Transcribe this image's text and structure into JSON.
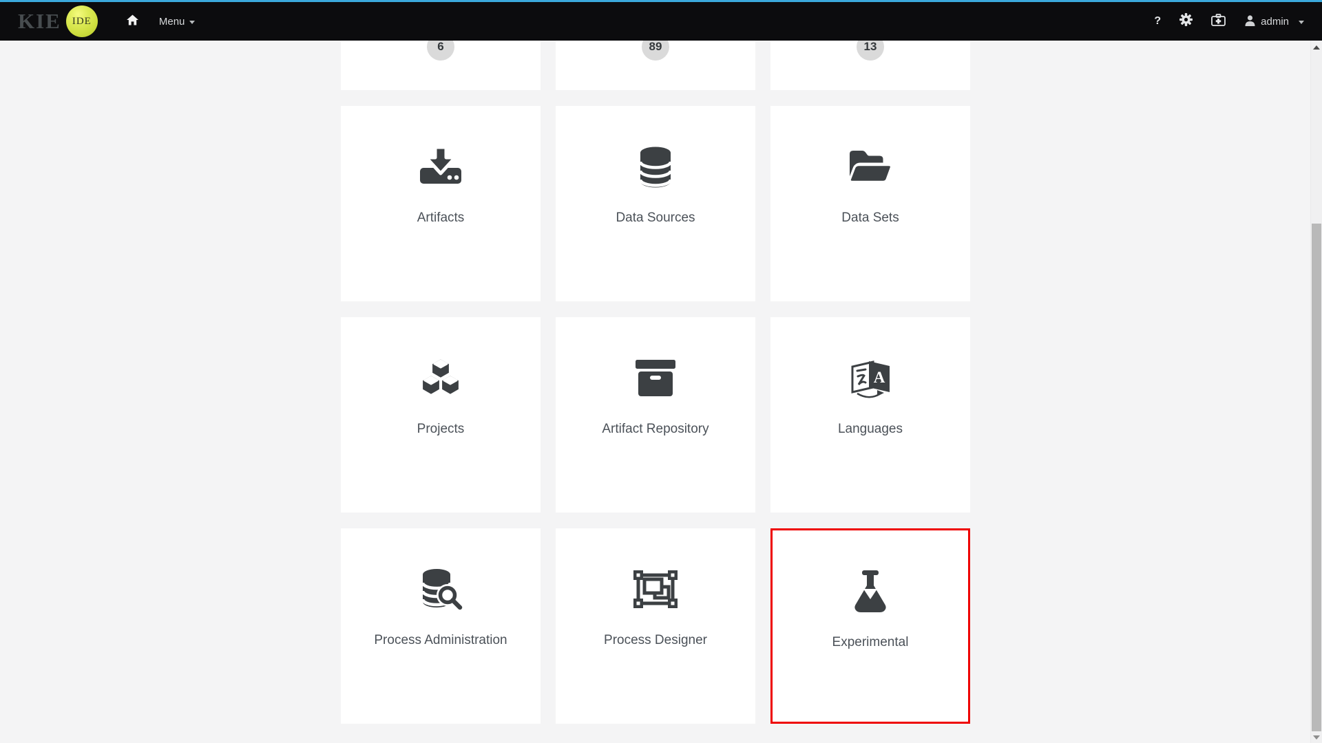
{
  "navbar": {
    "logo_text": "KIE",
    "logo_badge": "IDE",
    "menu_label": "Menu",
    "help_glyph": "?",
    "user_label": "admin",
    "icons": [
      "home-icon",
      "gear-icon",
      "medkit-icon",
      "user-icon",
      "chevron-down-icon"
    ]
  },
  "cutoff_cards": [
    {
      "count": "6"
    },
    {
      "count": "89"
    },
    {
      "count": "13"
    }
  ],
  "cards": [
    {
      "label": "Artifacts",
      "icon": "download-icon"
    },
    {
      "label": "Data Sources",
      "icon": "database-icon"
    },
    {
      "label": "Data Sets",
      "icon": "folder-open-icon"
    },
    {
      "label": "Projects",
      "icon": "cubes-icon"
    },
    {
      "label": "Artifact Repository",
      "icon": "archive-icon"
    },
    {
      "label": "Languages",
      "icon": "language-icon"
    },
    {
      "label": "Process Administration",
      "icon": "database-search-icon"
    },
    {
      "label": "Process Designer",
      "icon": "object-group-icon"
    },
    {
      "label": "Experimental",
      "icon": "flask-icon",
      "highlighted": true
    }
  ],
  "colors": {
    "accent_blue": "#3ba9dc",
    "navbar_bg": "#0c0c0e",
    "page_bg": "#f4f4f5",
    "card_bg": "#ffffff",
    "icon_color": "#3c4043",
    "label_color": "#4b5158",
    "badge_bg": "#dadada",
    "highlight_red": "#ee0000",
    "logo_circle": "#cddd3e"
  }
}
